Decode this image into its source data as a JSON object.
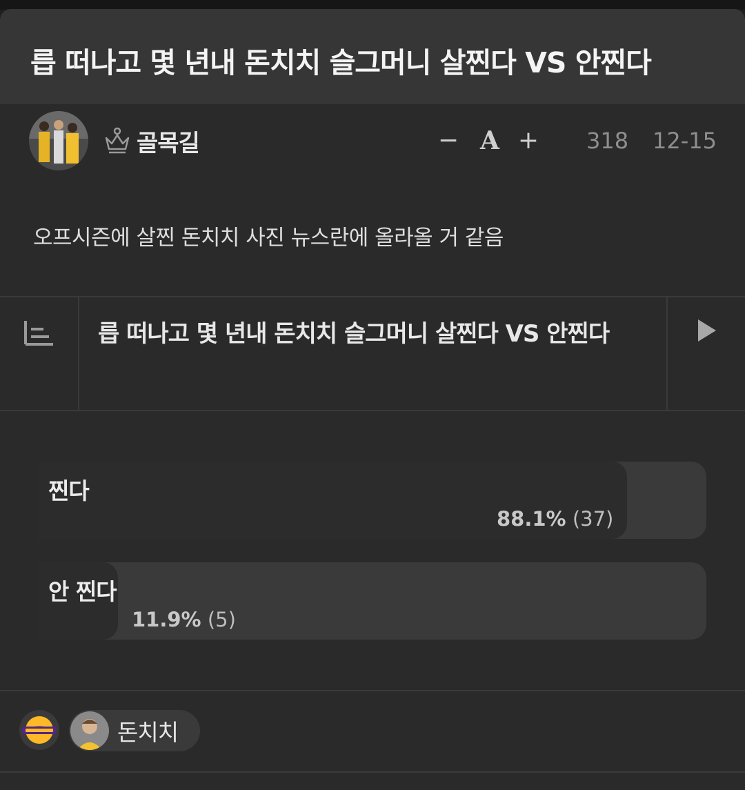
{
  "post": {
    "title": "릅 떠나고 몇 년내 돈치치 슬그머니 살찐다 VS 안찐다",
    "author": "골목길",
    "views": "318",
    "date": "12-15",
    "body": "오프시즌에 살찐 돈치치 사진 뉴스란에 올라올 거 같음"
  },
  "font_controls": {
    "decrease": "−",
    "font": "A",
    "increase": "+"
  },
  "poll": {
    "title": "릅 떠나고 몇 년내 돈치치 슬그머니 살찐다 VS 안찐다",
    "options": [
      {
        "label": "찐다",
        "percent_text": "88.1%",
        "count_text": "(37)",
        "fraction": 0.881
      },
      {
        "label": "안 찐다",
        "percent_text": "11.9%",
        "count_text": "(5)",
        "fraction": 0.119
      }
    ]
  },
  "tags": [
    {
      "label": "돈치치"
    }
  ],
  "icons": {
    "author_badge": "crown-outline-icon",
    "poll_list": "list-icon",
    "poll_play": "play-icon",
    "team_logo": "lakers-logo",
    "tag_avatar": "player-avatar"
  },
  "colors": {
    "background": "#2a2a2a",
    "title_bar": "#363636",
    "poll_track": "#3a3a3a",
    "lakers_gold": "#fdb927",
    "lakers_purple": "#552583"
  }
}
